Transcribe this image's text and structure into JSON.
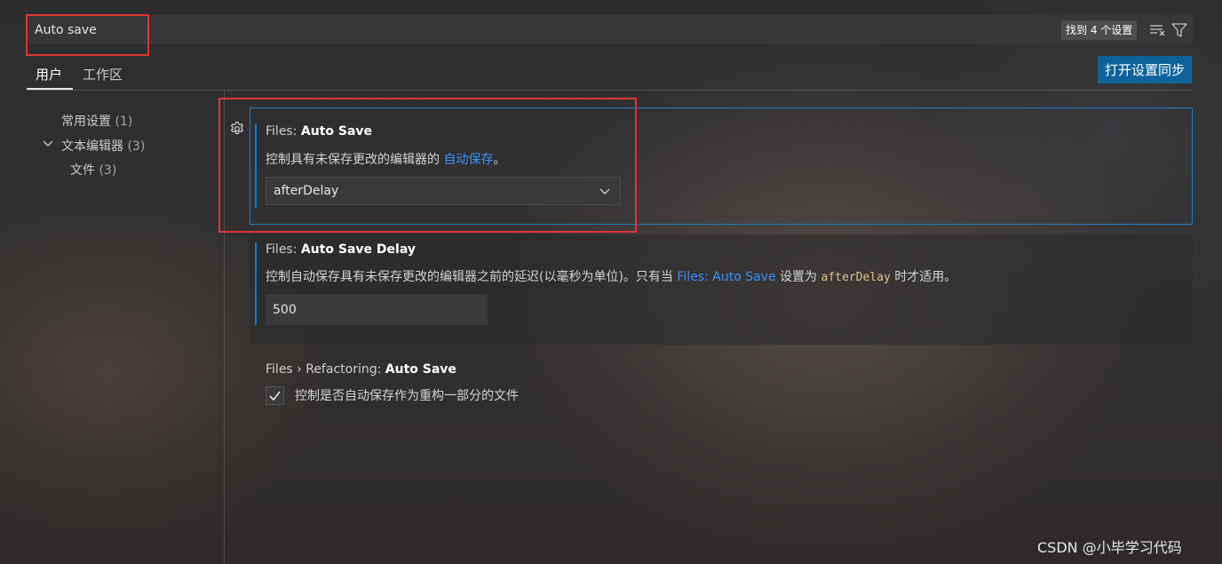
{
  "search": {
    "value": "Auto save",
    "result_count": "找到 4 个设置"
  },
  "tabs": [
    {
      "label": "用户",
      "active": true
    },
    {
      "label": "工作区",
      "active": false
    }
  ],
  "sync_button_label": "打开设置同步",
  "toc": {
    "items": [
      {
        "label": "常用设置",
        "count": "(1)"
      },
      {
        "label": "文本编辑器",
        "count": "(3)",
        "expanded": true
      },
      {
        "label": "文件",
        "count": "(3)"
      }
    ]
  },
  "settings": {
    "auto_save": {
      "category": "Files: ",
      "name": "Auto Save",
      "desc_before": "控制具有未保存更改的编辑器的 ",
      "desc_link": "自动保存",
      "desc_after": "。",
      "value": "afterDelay"
    },
    "auto_save_delay": {
      "category": "Files: ",
      "name": "Auto Save Delay",
      "desc_before": "控制自动保存具有未保存更改的编辑器之前的延迟(以毫秒为单位)。只有当 ",
      "desc_link": "Files: Auto Save",
      "desc_middle": " 设置为 ",
      "desc_code": "afterDelay",
      "desc_after": " 时才适用。",
      "value": "500"
    },
    "refactoring_auto_save": {
      "category": "Files › Refactoring: ",
      "name": "Auto Save",
      "desc": "控制是否自动保存作为重构一部分的文件",
      "checked": true
    }
  },
  "watermark": "CSDN @小毕学习代码",
  "colors": {
    "accent": "#0e639c",
    "link": "#3794ff",
    "focus_border": "#1f7ec3",
    "highlight_red": "#e03434"
  }
}
